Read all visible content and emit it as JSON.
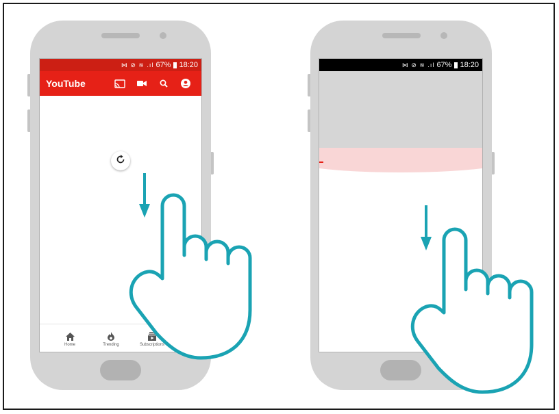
{
  "left_phone": {
    "status_bar": {
      "icons": "⋈ ⊘ ≋ .ıl",
      "battery_pct": "67%",
      "time": "18:20",
      "bg": "#cc1f14"
    },
    "app_bar": {
      "title": "YouTube",
      "bg": "#e62117",
      "actions": [
        {
          "icon": "cast-icon"
        },
        {
          "icon": "video-camera-icon"
        },
        {
          "icon": "search-icon"
        },
        {
          "icon": "account-icon"
        }
      ]
    },
    "content": {
      "refresh_icon": "refresh-icon"
    },
    "bottom_nav": [
      {
        "label": "Home",
        "icon": "home-icon"
      },
      {
        "label": "Trending",
        "icon": "flame-icon"
      },
      {
        "label": "Subscriptions",
        "icon": "subscriptions-icon"
      }
    ]
  },
  "right_phone": {
    "status_bar": {
      "icons": "⋈ ⊘ ≋ .ıl",
      "battery_pct": "67%",
      "time": "18:20",
      "bg": "#000000"
    },
    "pulled_area_color": "#d6d6d6",
    "overscroll_glow_color": "#f9d6d6"
  },
  "gesture": {
    "arrow_color": "#1aa3b3",
    "hand_color": "#1aa3b3",
    "arrow_icon": "down-arrow-icon",
    "hand_icon": "pointing-hand-icon"
  }
}
